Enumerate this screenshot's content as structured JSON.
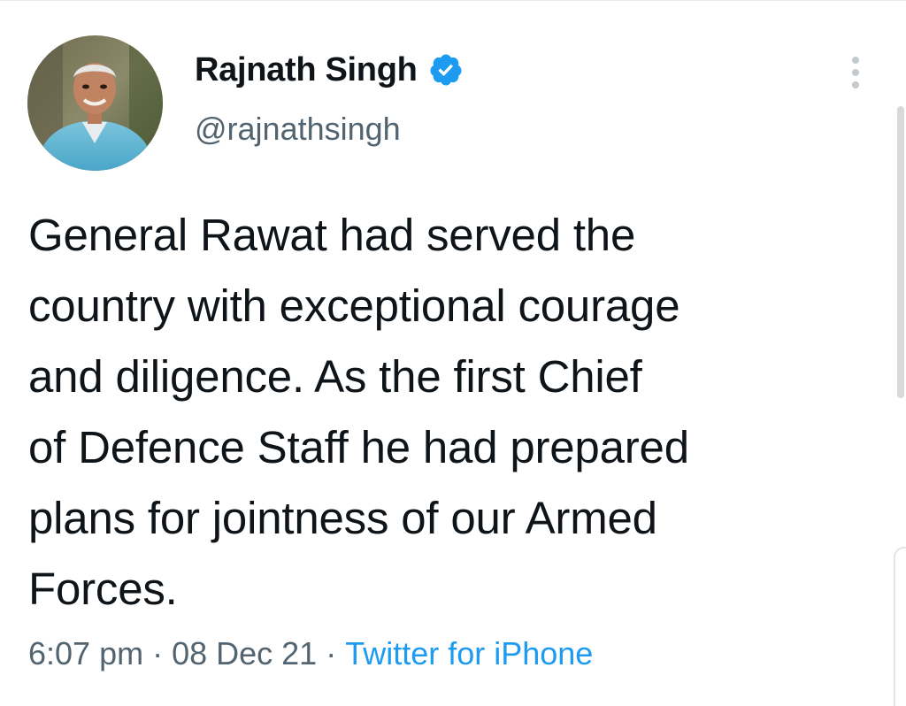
{
  "author": {
    "display_name": "Rajnath Singh",
    "handle": "@rajnathsingh",
    "verified": true,
    "avatar_icon": "profile-photo"
  },
  "tweet": {
    "lines": [
      "General Rawat had served the",
      "country with exceptional courage",
      "and diligence. As the first Chief",
      "of Defence Staff he had prepared",
      "plans for jointness of our Armed",
      "Forces."
    ]
  },
  "meta": {
    "time": "6:07 pm",
    "separator": "·",
    "date": "08 Dec 21",
    "source": "Twitter for iPhone"
  },
  "icons": {
    "verified": "verified-badge-icon",
    "more": "more-options-icon"
  },
  "colors": {
    "text": "#0f1419",
    "secondary": "#536471",
    "accent": "#1d9bf0"
  }
}
